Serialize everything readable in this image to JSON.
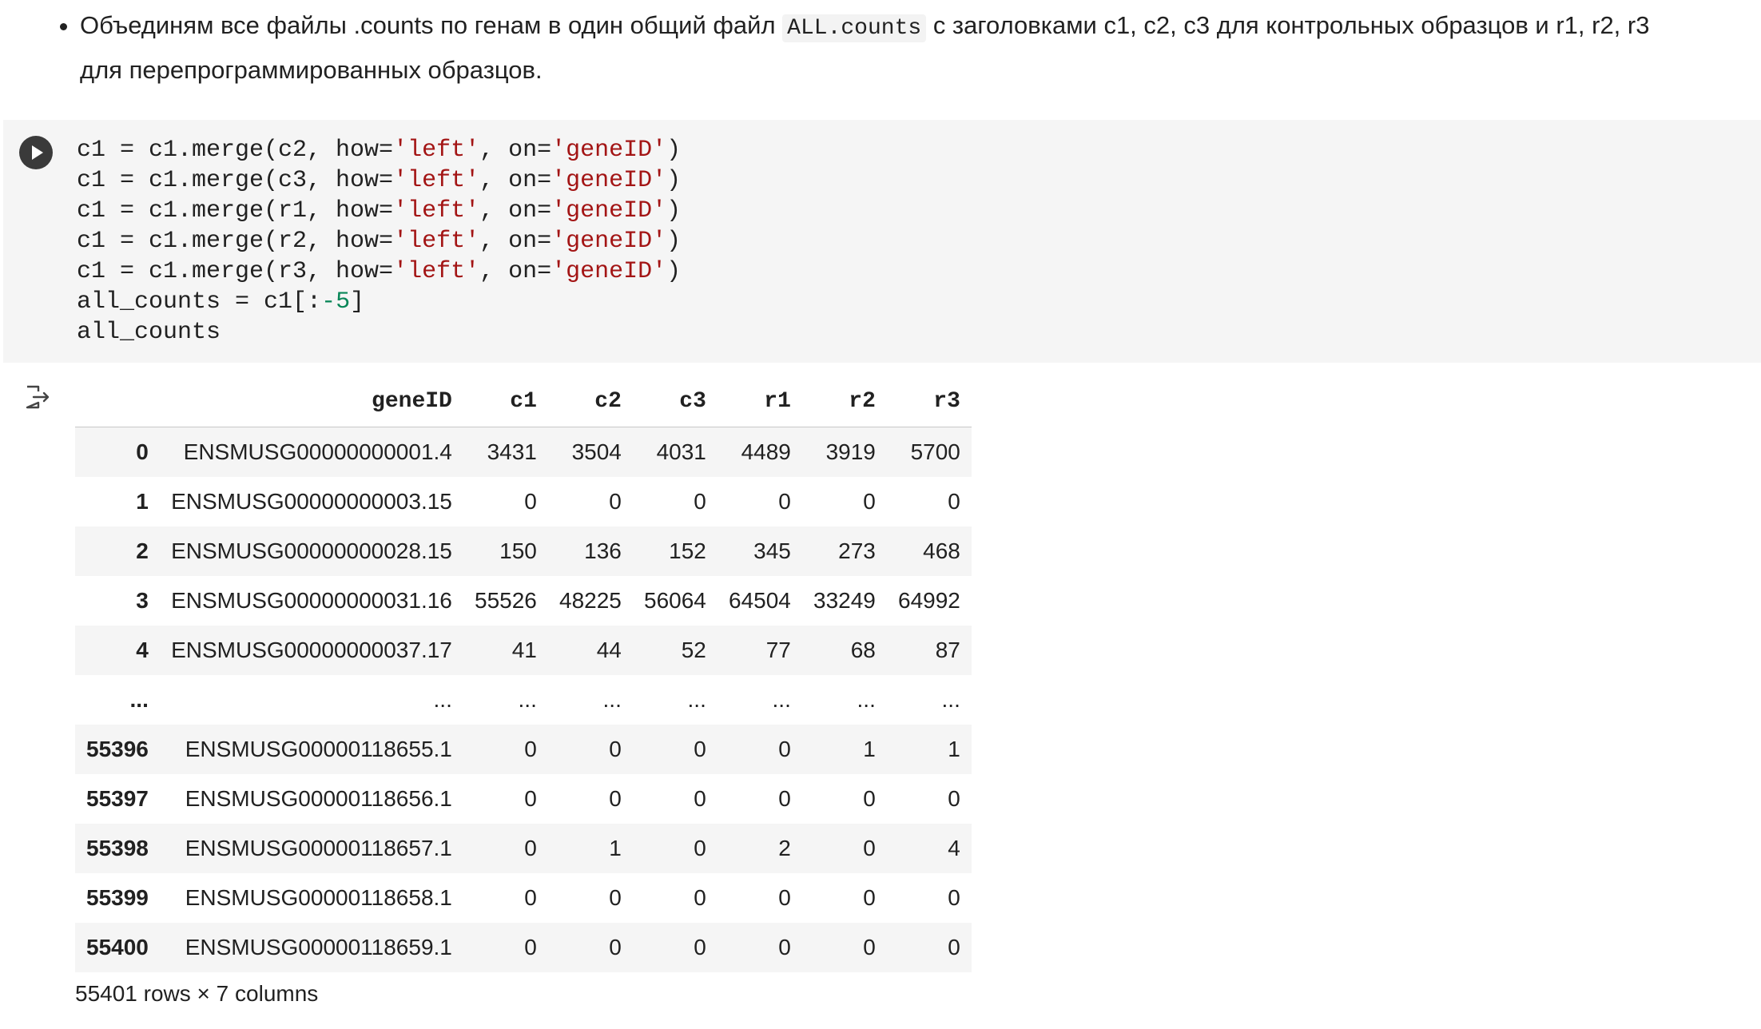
{
  "markdown": {
    "bullet_text_before": "Объединям все файлы .counts по генам в один общий файл ",
    "bullet_code": "ALL.counts",
    "bullet_text_after": " с заголовками c1, c2, c3 для контрольных образцов и r1, r2, r3 для перепрограммированных образцов."
  },
  "code_cell": {
    "run_button_icon": "play-icon",
    "lines": [
      {
        "plain": "c1 = c1.merge(c2, how=",
        "s1": "'left'",
        "mid": ", on=",
        "s2": "'geneID'",
        "end": ")"
      },
      {
        "plain": "c1 = c1.merge(c3, how=",
        "s1": "'left'",
        "mid": ", on=",
        "s2": "'geneID'",
        "end": ")"
      },
      {
        "plain": "c1 = c1.merge(r1, how=",
        "s1": "'left'",
        "mid": ", on=",
        "s2": "'geneID'",
        "end": ")"
      },
      {
        "plain": "c1 = c1.merge(r2, how=",
        "s1": "'left'",
        "mid": ", on=",
        "s2": "'geneID'",
        "end": ")"
      },
      {
        "plain": "c1 = c1.merge(r3, how=",
        "s1": "'left'",
        "mid": ", on=",
        "s2": "'geneID'",
        "end": ")"
      }
    ],
    "slice_line": {
      "before": "all_counts = c1[:",
      "number": "-5",
      "after": "]"
    },
    "last_line": "all_counts",
    "colors": {
      "string": "#a31515",
      "number": "#098658",
      "background": "#f5f5f5"
    }
  },
  "output": {
    "icon": "output-redirect-icon",
    "table": {
      "columns": [
        "",
        "geneID",
        "c1",
        "c2",
        "c3",
        "r1",
        "r2",
        "r3"
      ],
      "rows": [
        [
          "0",
          "ENSMUSG00000000001.4",
          "3431",
          "3504",
          "4031",
          "4489",
          "3919",
          "5700"
        ],
        [
          "1",
          "ENSMUSG00000000003.15",
          "0",
          "0",
          "0",
          "0",
          "0",
          "0"
        ],
        [
          "2",
          "ENSMUSG00000000028.15",
          "150",
          "136",
          "152",
          "345",
          "273",
          "468"
        ],
        [
          "3",
          "ENSMUSG00000000031.16",
          "55526",
          "48225",
          "56064",
          "64504",
          "33249",
          "64992"
        ],
        [
          "4",
          "ENSMUSG00000000037.17",
          "41",
          "44",
          "52",
          "77",
          "68",
          "87"
        ],
        [
          "...",
          "...",
          "...",
          "...",
          "...",
          "...",
          "...",
          "..."
        ],
        [
          "55396",
          "ENSMUSG00000118655.1",
          "0",
          "0",
          "0",
          "0",
          "1",
          "1"
        ],
        [
          "55397",
          "ENSMUSG00000118656.1",
          "0",
          "0",
          "0",
          "0",
          "0",
          "0"
        ],
        [
          "55398",
          "ENSMUSG00000118657.1",
          "0",
          "1",
          "0",
          "2",
          "0",
          "4"
        ],
        [
          "55399",
          "ENSMUSG00000118658.1",
          "0",
          "0",
          "0",
          "0",
          "0",
          "0"
        ],
        [
          "55400",
          "ENSMUSG00000118659.1",
          "0",
          "0",
          "0",
          "0",
          "0",
          "0"
        ]
      ]
    },
    "shape_text": "55401 rows × 7 columns"
  }
}
